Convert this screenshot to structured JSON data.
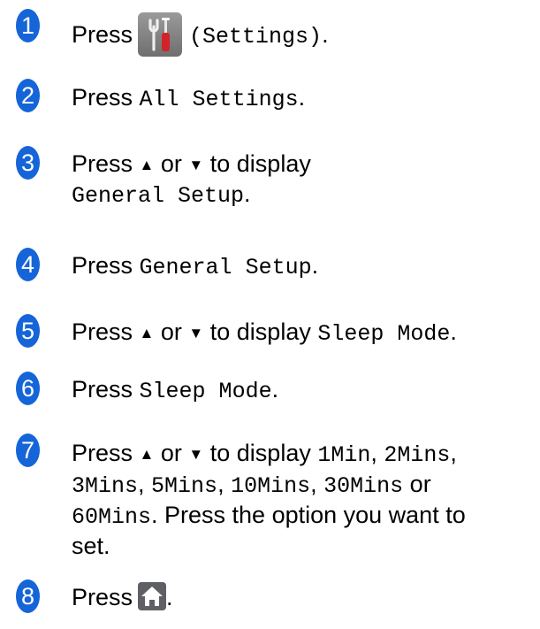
{
  "steps": [
    {
      "number": "1",
      "press": "Press",
      "button_label": "(Settings)",
      "period": "."
    },
    {
      "number": "2",
      "press": "Press",
      "option": "All Settings",
      "period": "."
    },
    {
      "number": "3",
      "press": "Press",
      "up": "▲",
      "or": "or",
      "down": "▼",
      "to_display": "to display",
      "option": "General Setup",
      "period": "."
    },
    {
      "number": "4",
      "press": "Press",
      "option": "General Setup",
      "period": "."
    },
    {
      "number": "5",
      "press": "Press",
      "up": "▲",
      "or": "or",
      "down": "▼",
      "to_display": "to display",
      "option": "Sleep Mode",
      "period": "."
    },
    {
      "number": "6",
      "press": "Press",
      "option": "Sleep Mode",
      "period": "."
    },
    {
      "number": "7",
      "press": "Press",
      "up": "▲",
      "or": "or",
      "down": "▼",
      "to_display": "to display",
      "options": [
        "1Min",
        "2Mins",
        "3Mins",
        "5Mins",
        "10Mins",
        "30Mins",
        "60Mins"
      ],
      "comma": ",",
      "or_word": "or",
      "instruction_end": ". Press the option you want to",
      "instruction_last": "set."
    },
    {
      "number": "8",
      "press": "Press",
      "period": "."
    }
  ],
  "icons": {
    "settings": "settings-tools-icon",
    "home": "home-icon"
  },
  "colors": {
    "step_badge": "#1565d8",
    "settings_red": "#d2232a"
  }
}
